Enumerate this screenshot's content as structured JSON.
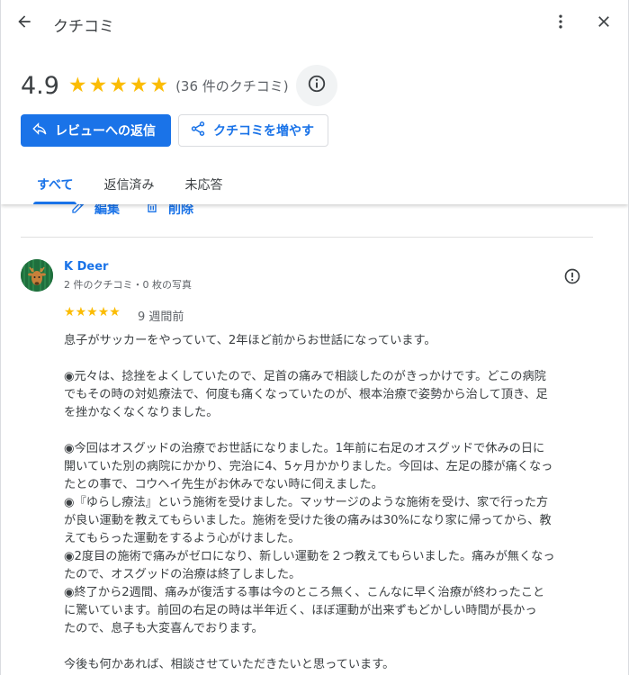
{
  "header": {
    "title": "クチコミ",
    "rating": "4.9",
    "stars": [
      "★",
      "★",
      "★",
      "★",
      "★"
    ],
    "review_count": "(36 件のクチコミ)"
  },
  "actions": {
    "reply_label": "レビューへの返信",
    "get_more_label": "クチコミを増やす"
  },
  "tabs": [
    {
      "label": "すべて",
      "active": true
    },
    {
      "label": "返信済み",
      "active": false
    },
    {
      "label": "未応答",
      "active": false
    }
  ],
  "prev_review_actions": {
    "edit_label": "編集",
    "delete_label": "削除"
  },
  "review": {
    "author": "K Deer",
    "meta": "2 件のクチコミ・0 枚の写真",
    "stars": [
      "★",
      "★",
      "★",
      "★",
      "★"
    ],
    "date": "9 週間前",
    "lines": [
      "息子がサッカーをやっていて、2年ほど前からお世話になっています。",
      "",
      "◉元々は、捻挫をよくしていたので、足首の痛みで相談したのがきっかけです。どこの病院",
      "でもその時の対処療法で、何度も痛くなっていたのが、根本治療で姿勢から治して頂き、足",
      "を挫かなくなくなりました。",
      "",
      "◉今回はオスグッドの治療でお世話になりました。1年前に右足のオスグッドで休みの日に",
      "開いていた別の病院にかかり、完治に4、5ヶ月かかりました。今回は、左足の膝が痛くなっ",
      "たとの事で、コウヘイ先生がお休みでない時に伺えました。",
      "◉『ゆらし療法』という施術を受けました。マッサージのような施術を受け、家で行った方",
      "が良い運動を教えてもらいました。施術を受けた後の痛みは30%になり家に帰ってから、教",
      "えてもらった運動をするよう心がけました。",
      "◉2度目の施術で痛みがゼロになり、新しい運動を２つ教えてもらいました。痛みが無くなっ",
      "たので、オスグッドの治療は終了しました。",
      "◉終了から2週間、痛みが復活する事は今のところ無く、こんなに早く治療が終わったこと",
      "に驚いています。前回の右足の時は半年近く、ほぼ運動が出来ずもどかしい時間が長かっ",
      "たので、息子も大変喜んでおります。",
      "",
      "今後も何かあれば、相談させていただきたいと思っています。"
    ]
  },
  "colors": {
    "accent": "#1a73e8",
    "star": "#fbbc04"
  },
  "icons": [
    "arrow-back-icon",
    "more-vert-icon",
    "close-icon",
    "info-icon",
    "reply-icon",
    "share-icon",
    "edit-icon",
    "delete-icon",
    "flag-icon"
  ]
}
